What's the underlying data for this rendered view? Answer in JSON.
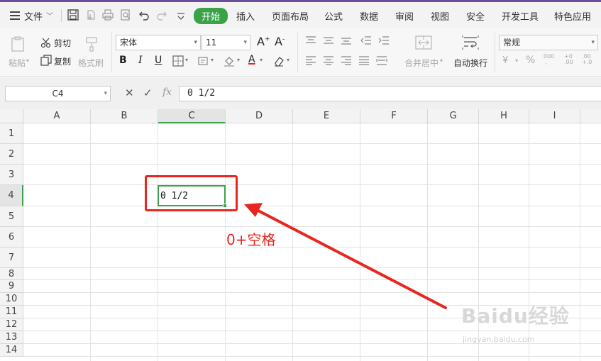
{
  "menubar": {
    "file_label": "文件",
    "tabs": [
      "开始",
      "插入",
      "页面布局",
      "公式",
      "数据",
      "审阅",
      "视图",
      "安全",
      "开发工具",
      "特色应用"
    ],
    "active_tab": "开始",
    "accent_color": "#3aa34a"
  },
  "ribbon": {
    "paste_label": "粘贴",
    "cut_label": "剪切",
    "copy_label": "复制",
    "format_painter_label": "格式刷",
    "font_name": "宋体",
    "font_size": "11",
    "bold": "B",
    "italic": "I",
    "underline": "U",
    "merge_center_label": "合并居中",
    "wrap_text_label": "自动换行",
    "number_format": "常规"
  },
  "formula_bar": {
    "cell_ref": "C4",
    "fx_label": "fx",
    "formula": "0 1/2"
  },
  "grid": {
    "columns": [
      "A",
      "B",
      "C",
      "D",
      "E",
      "F",
      "G",
      "H",
      "I"
    ],
    "rows": [
      "1",
      "2",
      "3",
      "4",
      "5",
      "6",
      "7",
      "8",
      "9",
      "10",
      "11",
      "12",
      "13",
      "14"
    ],
    "selected_column": "C",
    "selected_row": "4",
    "active_cell_value": "0 1/2"
  },
  "annotation": {
    "text": "0+空格",
    "color": "#e8261f"
  },
  "watermark": {
    "text": "Baidu经验",
    "url_text": "jingyan.baidu.com"
  }
}
